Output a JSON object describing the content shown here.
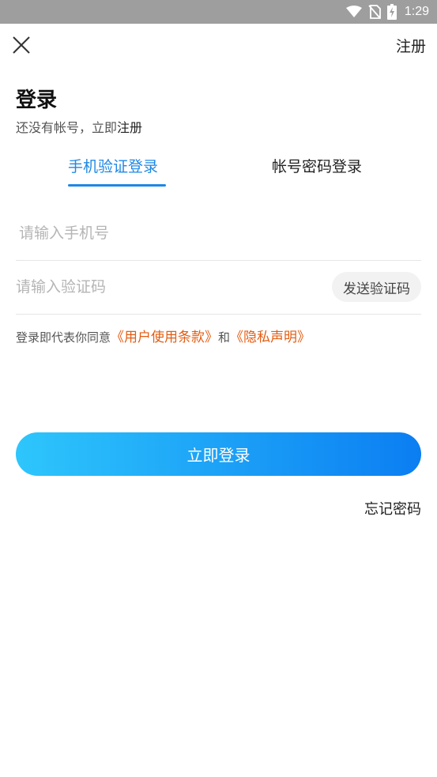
{
  "status_bar": {
    "time": "1:29",
    "icons": [
      "wifi-icon",
      "no-sim-icon",
      "battery-charging-icon"
    ]
  },
  "header": {
    "close_icon": "close-icon",
    "register_label": "注册"
  },
  "title": "登录",
  "subtitle": {
    "prefix": "还没有帐号，立即",
    "register_link": "注册"
  },
  "tabs": [
    {
      "label": "手机验证登录",
      "active": true
    },
    {
      "label": "帐号密码登录",
      "active": false
    }
  ],
  "phone_field": {
    "placeholder": "请输入手机号",
    "value": ""
  },
  "code_field": {
    "placeholder": "请输入验证码",
    "value": "",
    "send_button_label": "发送验证码"
  },
  "agreement": {
    "prefix": "登录即代表你同意",
    "terms_link": "《用户使用条款》",
    "conjunction": "和",
    "privacy_link": "《隐私声明》"
  },
  "login_button_label": "立即登录",
  "forgot_password_label": "忘记密码",
  "colors": {
    "accent": "#1e88e5",
    "link_orange": "#e35d12",
    "button_gradient_start": "#2ec6fc",
    "button_gradient_end": "#0b7ef2",
    "status_bar": "#9e9e9e"
  }
}
